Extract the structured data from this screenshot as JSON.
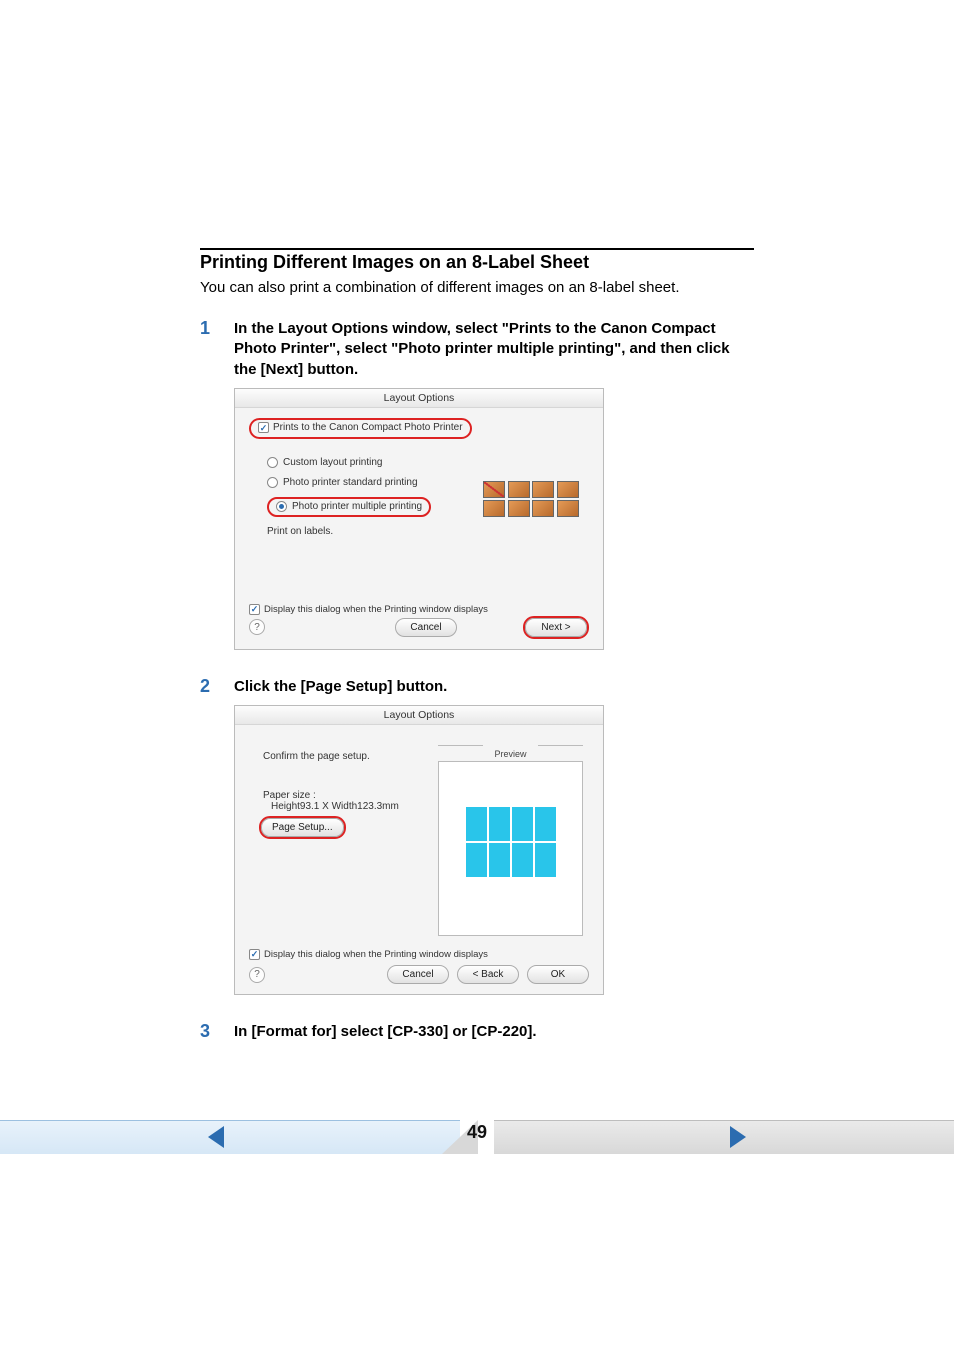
{
  "section": {
    "title": "Printing Different Images on an 8-Label Sheet",
    "intro": "You can also print a combination of different images on an 8-label sheet."
  },
  "steps": {
    "s1": {
      "num": "1",
      "text": "In the Layout Options window, select \"Prints to the Canon Compact Photo Printer\", select \"Photo printer multiple printing\", and then click the [Next] button."
    },
    "s2": {
      "num": "2",
      "text": "Click the [Page Setup] button."
    },
    "s3": {
      "num": "3",
      "text": "In [Format for] select [CP-330] or [CP-220]."
    }
  },
  "dialog1": {
    "title": "Layout Options",
    "prints_to": "Prints to the Canon Compact Photo Printer",
    "opt_custom": "Custom layout printing",
    "opt_standard": "Photo printer standard printing",
    "opt_multiple": "Photo printer multiple printing",
    "print_on_labels": "Print on labels.",
    "display_dialog": "Display this dialog when the Printing window displays",
    "cancel": "Cancel",
    "next": "Next >",
    "help": "?"
  },
  "dialog2": {
    "title": "Layout Options",
    "confirm": "Confirm the page setup.",
    "paper_size_label": "Paper size :",
    "paper_size_value": "Height93.1 X Width123.3mm",
    "page_setup": "Page Setup...",
    "preview_label": "Preview",
    "display_dialog": "Display this dialog when the Printing window displays",
    "cancel": "Cancel",
    "back": "< Back",
    "ok": "OK",
    "help": "?"
  },
  "page_number": "49"
}
